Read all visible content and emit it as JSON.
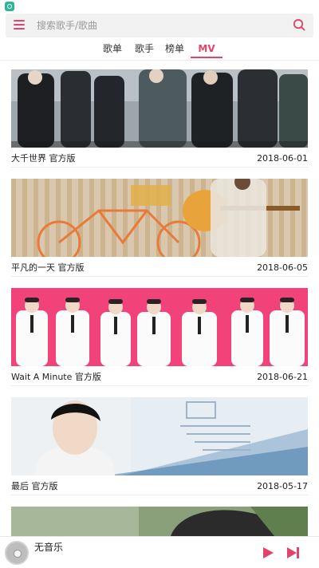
{
  "search": {
    "placeholder": "搜索歌手/歌曲"
  },
  "tabs": [
    {
      "label": "歌单"
    },
    {
      "label": "歌手"
    },
    {
      "label": "榜单"
    },
    {
      "label": "MV"
    }
  ],
  "active_tab": "MV",
  "mv_list": [
    {
      "title": "大千世界 官方版",
      "date": "2018-06-01"
    },
    {
      "title": "平凡的一天 官方版",
      "date": "2018-06-05"
    },
    {
      "title": "Wait A Minute 官方版",
      "date": "2018-06-21"
    },
    {
      "title": "最后 官方版",
      "date": "2018-05-17"
    }
  ],
  "player": {
    "now_playing": "无音乐"
  },
  "colors": {
    "accent": "#e2436b",
    "thumb_pink": "#f2427a"
  },
  "icons": [
    "menu-icon",
    "search-icon",
    "play-icon",
    "next-icon",
    "album-disc-icon"
  ]
}
